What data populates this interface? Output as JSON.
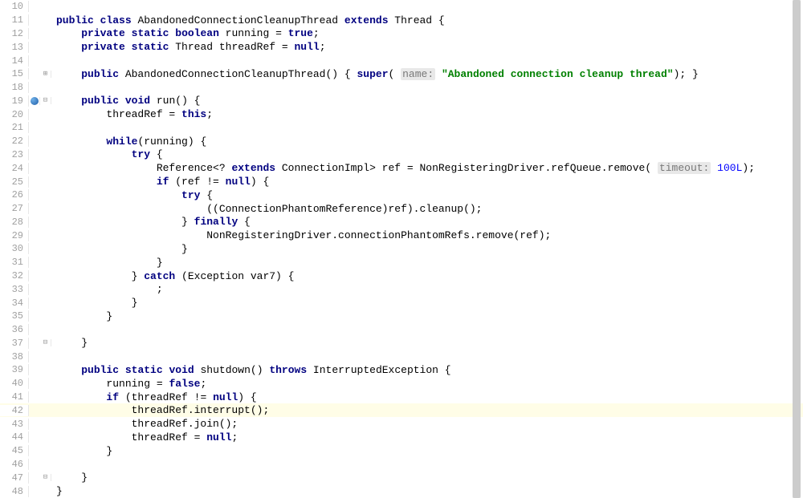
{
  "highlightedLine": 42,
  "breakpointLine": 19,
  "foldPlusLine": 15,
  "foldMinusLines": [
    19,
    37,
    47
  ],
  "lines": [
    {
      "n": 10,
      "tokens": [
        {
          "t": "",
          "c": "plain"
        }
      ]
    },
    {
      "n": 11,
      "tokens": [
        {
          "t": "public",
          "c": "kw"
        },
        {
          "t": " ",
          "c": "plain"
        },
        {
          "t": "class",
          "c": "kw"
        },
        {
          "t": " AbandonedConnectionCleanupThread ",
          "c": "plain"
        },
        {
          "t": "extends",
          "c": "kw"
        },
        {
          "t": " Thread {",
          "c": "plain"
        }
      ]
    },
    {
      "n": 12,
      "tokens": [
        {
          "t": "    ",
          "c": "plain"
        },
        {
          "t": "private",
          "c": "kw"
        },
        {
          "t": " ",
          "c": "plain"
        },
        {
          "t": "static",
          "c": "kw"
        },
        {
          "t": " ",
          "c": "plain"
        },
        {
          "t": "boolean",
          "c": "kw"
        },
        {
          "t": " running = ",
          "c": "plain"
        },
        {
          "t": "true",
          "c": "kw"
        },
        {
          "t": ";",
          "c": "plain"
        }
      ]
    },
    {
      "n": 13,
      "tokens": [
        {
          "t": "    ",
          "c": "plain"
        },
        {
          "t": "private",
          "c": "kw"
        },
        {
          "t": " ",
          "c": "plain"
        },
        {
          "t": "static",
          "c": "kw"
        },
        {
          "t": " Thread threadRef = ",
          "c": "plain"
        },
        {
          "t": "null",
          "c": "kw"
        },
        {
          "t": ";",
          "c": "plain"
        }
      ]
    },
    {
      "n": 14,
      "tokens": [
        {
          "t": "",
          "c": "plain"
        }
      ]
    },
    {
      "n": 15,
      "tokens": [
        {
          "t": "    ",
          "c": "plain"
        },
        {
          "t": "public",
          "c": "kw"
        },
        {
          "t": " AbandonedConnectionCleanupThread() { ",
          "c": "plain"
        },
        {
          "t": "super",
          "c": "kw"
        },
        {
          "t": "( ",
          "c": "plain"
        },
        {
          "t": "name:",
          "c": "hint-bg"
        },
        {
          "t": " ",
          "c": "plain"
        },
        {
          "t": "\"Abandoned connection cleanup thread\"",
          "c": "str"
        },
        {
          "t": "); }",
          "c": "plain"
        }
      ]
    },
    {
      "n": 18,
      "tokens": [
        {
          "t": "",
          "c": "plain"
        }
      ]
    },
    {
      "n": 19,
      "tokens": [
        {
          "t": "    ",
          "c": "plain"
        },
        {
          "t": "public",
          "c": "kw"
        },
        {
          "t": " ",
          "c": "plain"
        },
        {
          "t": "void",
          "c": "kw"
        },
        {
          "t": " run() {",
          "c": "plain"
        }
      ]
    },
    {
      "n": 20,
      "tokens": [
        {
          "t": "        threadRef = ",
          "c": "plain"
        },
        {
          "t": "this",
          "c": "kw"
        },
        {
          "t": ";",
          "c": "plain"
        }
      ]
    },
    {
      "n": 21,
      "tokens": [
        {
          "t": "",
          "c": "plain"
        }
      ]
    },
    {
      "n": 22,
      "tokens": [
        {
          "t": "        ",
          "c": "plain"
        },
        {
          "t": "while",
          "c": "kw"
        },
        {
          "t": "(running) {",
          "c": "plain"
        }
      ]
    },
    {
      "n": 23,
      "tokens": [
        {
          "t": "            ",
          "c": "plain"
        },
        {
          "t": "try",
          "c": "kw"
        },
        {
          "t": " {",
          "c": "plain"
        }
      ]
    },
    {
      "n": 24,
      "tokens": [
        {
          "t": "                Reference<? ",
          "c": "plain"
        },
        {
          "t": "extends",
          "c": "kw"
        },
        {
          "t": " ConnectionImpl> ref = NonRegisteringDriver.refQueue.remove( ",
          "c": "plain"
        },
        {
          "t": "timeout:",
          "c": "hint-bg"
        },
        {
          "t": " ",
          "c": "plain"
        },
        {
          "t": "100L",
          "c": "num"
        },
        {
          "t": ");",
          "c": "plain"
        }
      ]
    },
    {
      "n": 25,
      "tokens": [
        {
          "t": "                ",
          "c": "plain"
        },
        {
          "t": "if",
          "c": "kw"
        },
        {
          "t": " (ref != ",
          "c": "plain"
        },
        {
          "t": "null",
          "c": "kw"
        },
        {
          "t": ") {",
          "c": "plain"
        }
      ]
    },
    {
      "n": 26,
      "tokens": [
        {
          "t": "                    ",
          "c": "plain"
        },
        {
          "t": "try",
          "c": "kw"
        },
        {
          "t": " {",
          "c": "plain"
        }
      ]
    },
    {
      "n": 27,
      "tokens": [
        {
          "t": "                        ((ConnectionPhantomReference)ref).cleanup();",
          "c": "plain"
        }
      ]
    },
    {
      "n": 28,
      "tokens": [
        {
          "t": "                    } ",
          "c": "plain"
        },
        {
          "t": "finally",
          "c": "kw"
        },
        {
          "t": " {",
          "c": "plain"
        }
      ]
    },
    {
      "n": 29,
      "tokens": [
        {
          "t": "                        NonRegisteringDriver.connectionPhantomRefs.remove(ref);",
          "c": "plain"
        }
      ]
    },
    {
      "n": 30,
      "tokens": [
        {
          "t": "                    }",
          "c": "plain"
        }
      ]
    },
    {
      "n": 31,
      "tokens": [
        {
          "t": "                }",
          "c": "plain"
        }
      ]
    },
    {
      "n": 32,
      "tokens": [
        {
          "t": "            } ",
          "c": "plain"
        },
        {
          "t": "catch",
          "c": "kw"
        },
        {
          "t": " (Exception var7) {",
          "c": "plain"
        }
      ]
    },
    {
      "n": 33,
      "tokens": [
        {
          "t": "                ;",
          "c": "plain"
        }
      ]
    },
    {
      "n": 34,
      "tokens": [
        {
          "t": "            }",
          "c": "plain"
        }
      ]
    },
    {
      "n": 35,
      "tokens": [
        {
          "t": "        }",
          "c": "plain"
        }
      ]
    },
    {
      "n": 36,
      "tokens": [
        {
          "t": "",
          "c": "plain"
        }
      ]
    },
    {
      "n": 37,
      "tokens": [
        {
          "t": "    }",
          "c": "plain"
        }
      ]
    },
    {
      "n": 38,
      "tokens": [
        {
          "t": "",
          "c": "plain"
        }
      ]
    },
    {
      "n": 39,
      "tokens": [
        {
          "t": "    ",
          "c": "plain"
        },
        {
          "t": "public",
          "c": "kw"
        },
        {
          "t": " ",
          "c": "plain"
        },
        {
          "t": "static",
          "c": "kw"
        },
        {
          "t": " ",
          "c": "plain"
        },
        {
          "t": "void",
          "c": "kw"
        },
        {
          "t": " shutdown() ",
          "c": "plain"
        },
        {
          "t": "throws",
          "c": "kw"
        },
        {
          "t": " InterruptedException {",
          "c": "plain"
        }
      ]
    },
    {
      "n": 40,
      "tokens": [
        {
          "t": "        running = ",
          "c": "plain"
        },
        {
          "t": "false",
          "c": "kw"
        },
        {
          "t": ";",
          "c": "plain"
        }
      ]
    },
    {
      "n": 41,
      "tokens": [
        {
          "t": "        ",
          "c": "plain"
        },
        {
          "t": "if",
          "c": "kw"
        },
        {
          "t": " (threadRef != ",
          "c": "plain"
        },
        {
          "t": "null",
          "c": "kw"
        },
        {
          "t": ") {",
          "c": "plain"
        }
      ]
    },
    {
      "n": 42,
      "tokens": [
        {
          "t": "            threadRef.interrupt();",
          "c": "plain"
        }
      ]
    },
    {
      "n": 43,
      "tokens": [
        {
          "t": "            threadRef.join();",
          "c": "plain"
        }
      ]
    },
    {
      "n": 44,
      "tokens": [
        {
          "t": "            threadRef = ",
          "c": "plain"
        },
        {
          "t": "null",
          "c": "kw"
        },
        {
          "t": ";",
          "c": "plain"
        }
      ]
    },
    {
      "n": 45,
      "tokens": [
        {
          "t": "        }",
          "c": "plain"
        }
      ]
    },
    {
      "n": 46,
      "tokens": [
        {
          "t": "",
          "c": "plain"
        }
      ]
    },
    {
      "n": 47,
      "tokens": [
        {
          "t": "    }",
          "c": "plain"
        }
      ]
    },
    {
      "n": 48,
      "tokens": [
        {
          "t": "}",
          "c": "plain"
        }
      ]
    }
  ]
}
